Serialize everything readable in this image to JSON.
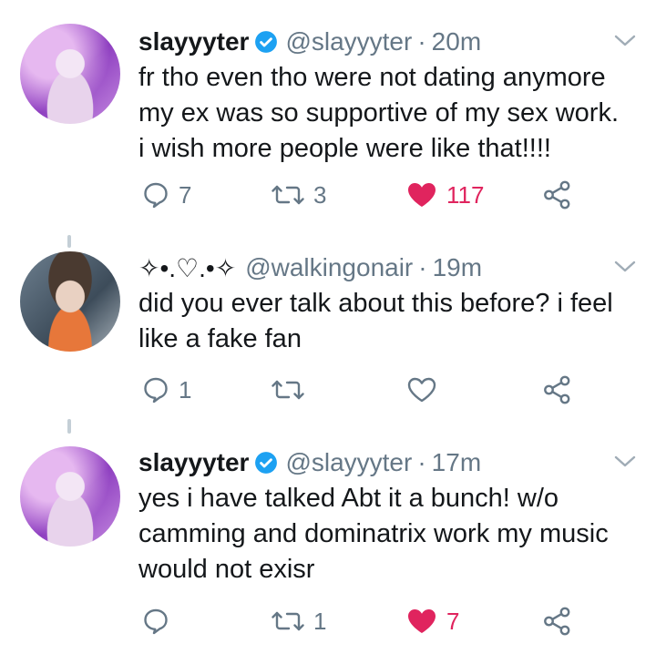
{
  "tweets": [
    {
      "name": "slayyyter",
      "handle": "@slayyyter",
      "separator": "·",
      "time": "20m",
      "lines": [
        "fr tho even tho were not dating anymore",
        "my ex was so supportive of my sex work.",
        "i wish more people were like that!!!!"
      ],
      "replies": "7",
      "retweets": "3",
      "likes": "117",
      "liked": true,
      "verified": true
    },
    {
      "name": "✧•.♡.•✧",
      "handle": "@walkingonair",
      "separator": "·",
      "time": "19m",
      "lines": [
        "did you ever talk about this before? i feel",
        "like a fake fan"
      ],
      "replies": "1",
      "retweets": "",
      "likes": "",
      "liked": false,
      "verified": false
    },
    {
      "name": "slayyyter",
      "handle": "@slayyyter",
      "separator": "·",
      "time": "17m",
      "lines": [
        "yes i have talked Abt it a bunch! w/o",
        "camming and dominatrix work my music",
        "would not exisr"
      ],
      "replies": "",
      "retweets": "1",
      "likes": "7",
      "liked": true,
      "verified": true
    }
  ],
  "colors": {
    "like_active": "#e0245e",
    "verified": "#1da1f2",
    "icon_gray": "#657786",
    "thread_line": "#c4cfd6"
  },
  "icons": [
    "reply-icon",
    "retweet-icon",
    "like-icon",
    "share-icon",
    "chevron-down-icon",
    "verified-badge-icon"
  ]
}
